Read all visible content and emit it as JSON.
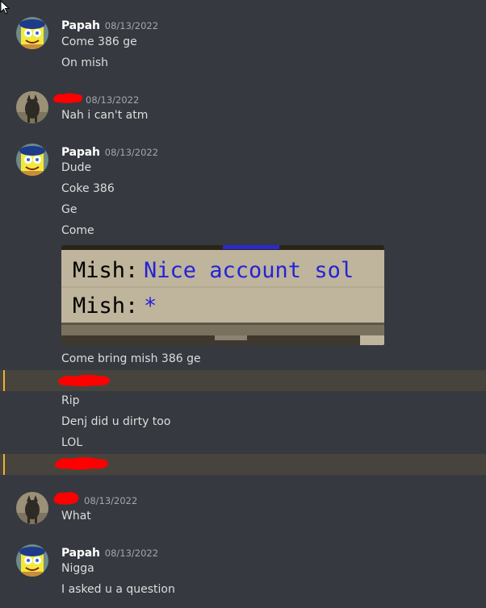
{
  "colors": {
    "background": "#36393f",
    "mention_highlight": "#47443e",
    "mention_bar": "#f0b232",
    "redaction": "#ff0000",
    "chat_text_blue": "#2323d8"
  },
  "messages": [
    {
      "username": "Papah",
      "timestamp": "08/13/2022",
      "avatar": "spongebob-avatar",
      "lines": [
        "Come 386 ge",
        "On mish"
      ]
    },
    {
      "username": "",
      "timestamp": "08/13/2022",
      "avatar": "dog-avatar",
      "lines": [
        "Nah i can't atm"
      ]
    },
    {
      "username": "Papah",
      "timestamp": "08/13/2022",
      "avatar": "spongebob-avatar",
      "lines": [
        "Dude",
        "Coke 386",
        "Ge",
        "Come"
      ],
      "attachment": {
        "chat_lines": [
          {
            "speaker": "Mish:",
            "text": "Nice account sol"
          },
          {
            "speaker": "Mish:",
            "text": "*"
          }
        ]
      },
      "lines_after": [
        "Come bring mish 386 ge"
      ],
      "lines_after_mention": [
        "Rip",
        "Denj did u dirty too",
        "LOL"
      ]
    },
    {
      "username": "",
      "timestamp": "08/13/2022",
      "avatar": "dog-avatar",
      "lines": [
        "What"
      ]
    },
    {
      "username": "Papah",
      "timestamp": "08/13/2022",
      "avatar": "spongebob-avatar",
      "lines": [
        "Nigga",
        "I asked u a question"
      ]
    }
  ]
}
